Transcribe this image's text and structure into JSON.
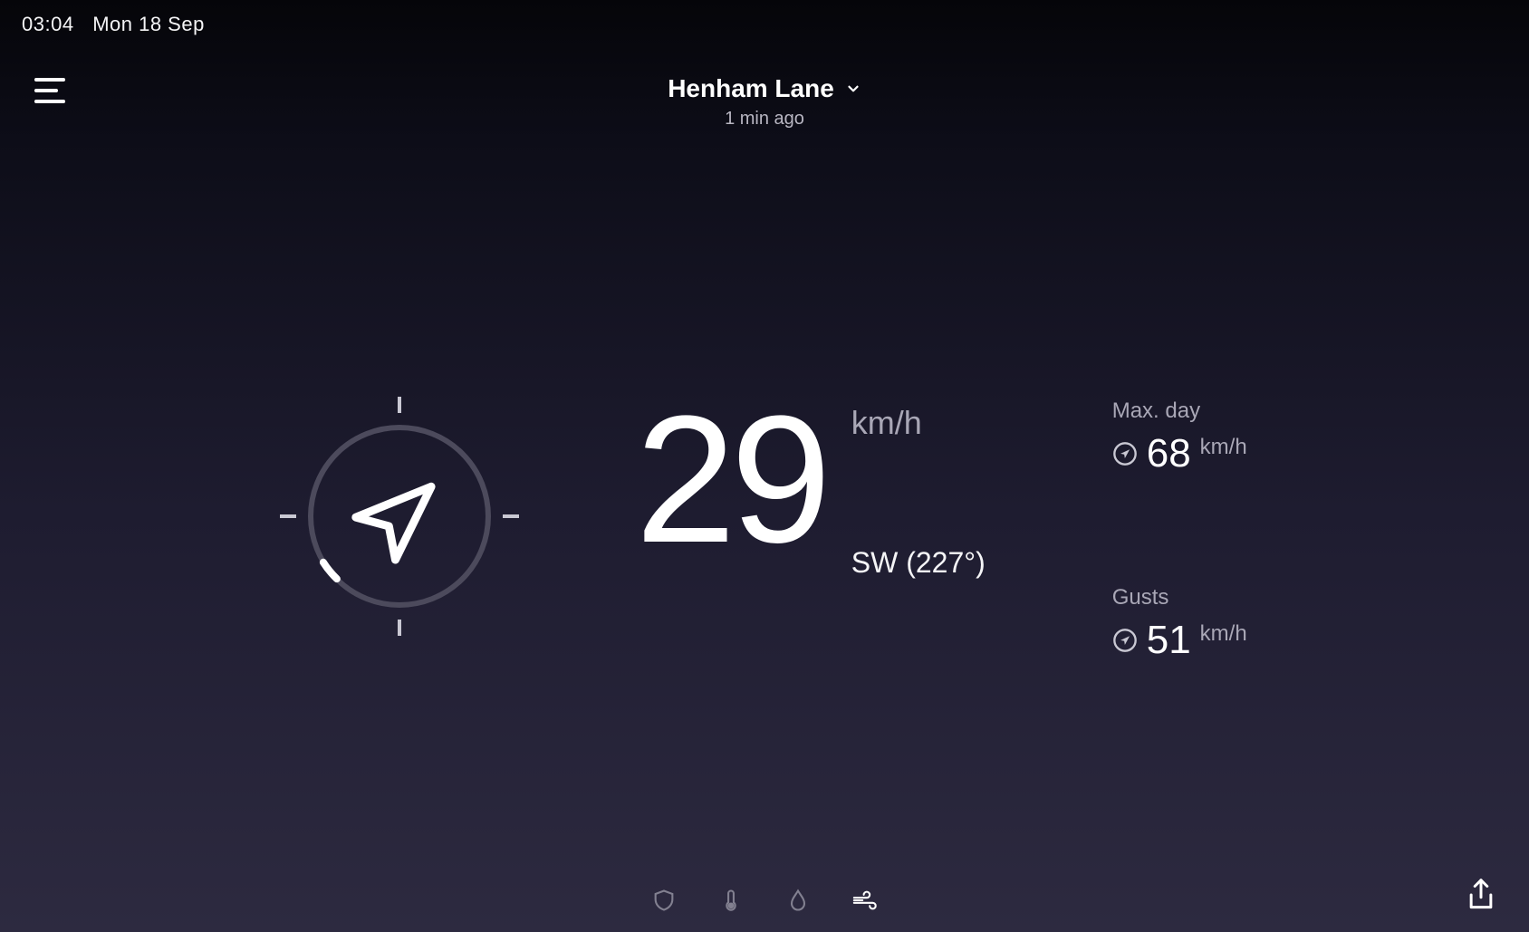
{
  "status_bar": {
    "time": "03:04",
    "date": "Mon 18 Sep"
  },
  "header": {
    "location_name": "Henham Lane",
    "updated_ago": "1 min ago"
  },
  "wind": {
    "current_value": "29",
    "unit": "km/h",
    "direction_label": "SW (227°)",
    "direction_degrees": 227
  },
  "stats": {
    "max_day": {
      "label": "Max. day",
      "value": "68",
      "unit": "km/h"
    },
    "gusts": {
      "label": "Gusts",
      "value": "51",
      "unit": "km/h"
    }
  },
  "bottom_tabs": [
    {
      "name": "shield",
      "active": false
    },
    {
      "name": "thermometer",
      "active": false
    },
    {
      "name": "droplet",
      "active": false
    },
    {
      "name": "wind",
      "active": true
    }
  ]
}
